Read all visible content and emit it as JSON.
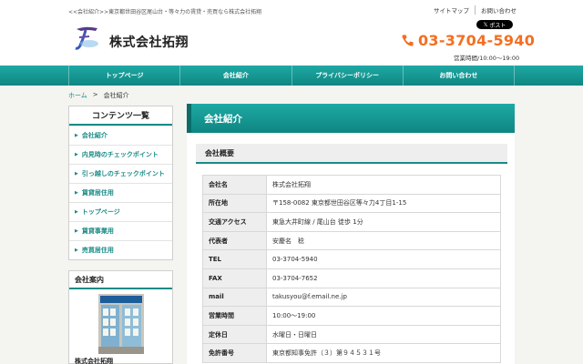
{
  "header": {
    "tagline": "<<会社紹介>>東京都世田谷区尾山台・等々力の賃貸・売買なら株式会社拓翔",
    "top_links": [
      "サイトマップ",
      "お問い合わせ"
    ],
    "tweet_label": "ポスト",
    "company_name": "株式会社拓翔",
    "phone": "03-3704-5940",
    "hours": "営業時間/10:00〜19:00"
  },
  "nav": {
    "items": [
      "トップページ",
      "会社紹介",
      "プライバシーポリシー",
      "お問い合わせ"
    ]
  },
  "breadcrumb": {
    "home": "ホーム",
    "separator": ">",
    "current": "会社紹介"
  },
  "sidebar": {
    "heading": "コンテンツ一覧",
    "items": [
      "会社紹介",
      "内見時のチェックポイント",
      "引っ越しのチェックポイント",
      "賃貸居住用",
      "トップページ",
      "賃貸事業用",
      "売買居住用"
    ],
    "company_heading": "会社案内",
    "company_name": "株式会社拓翔"
  },
  "main": {
    "title": "会社紹介",
    "section_title": "会社概要",
    "rows": [
      {
        "label": "会社名",
        "value": "株式会社拓翔"
      },
      {
        "label": "所在地",
        "value": "〒158-0082 東京都世田谷区等々力4丁目1-15"
      },
      {
        "label": "交通アクセス",
        "value": "東急大井町線 / 尾山台 徒歩 1分"
      },
      {
        "label": "代表者",
        "value": "安慶名　稔"
      },
      {
        "label": "TEL",
        "value": "03-3704-5940"
      },
      {
        "label": "FAX",
        "value": "03-3704-7652"
      },
      {
        "label": "mail",
        "value": "takusyou@f.email.ne.jp"
      },
      {
        "label": "営業時間",
        "value": "10:00〜19:00"
      },
      {
        "label": "定休日",
        "value": "水曜日・日曜日"
      },
      {
        "label": "免許番号",
        "value": "東京都知事免許（３）第９４５３１号"
      }
    ]
  },
  "colors": {
    "accent": "#1a8b86",
    "phone": "#f36f21"
  }
}
